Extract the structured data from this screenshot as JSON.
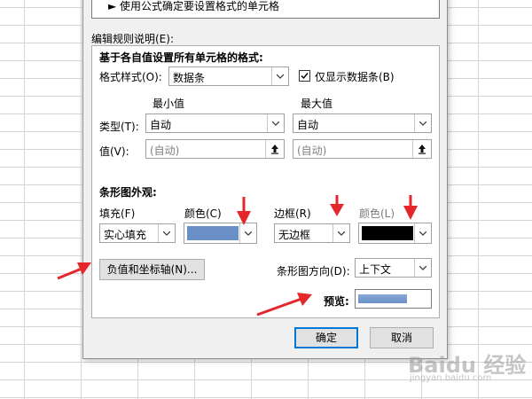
{
  "dialog": {
    "rule_type_item": "► 使用公式确定要设置格式的单元格",
    "edit_desc_label": "编辑规则说明(E):",
    "section_title": "基于各自值设置所有单元格的格式:",
    "format_style_label": "格式样式(O):",
    "format_style_value": "数据条",
    "show_bar_only_label": "仅显示数据条(B)",
    "show_bar_only_checked": true,
    "min_header": "最小值",
    "max_header": "最大值",
    "type_label": "类型(T):",
    "value_label": "值(V):",
    "min_type": "自动",
    "max_type": "自动",
    "min_value": "(自动)",
    "max_value": "(自动)",
    "bar_appearance_title": "条形图外观:",
    "fill_label": "填充(F)",
    "fill_color_label": "颜色(C)",
    "border_label": "边框(R)",
    "border_color_label": "颜色(L)",
    "fill_value": "实心填充",
    "border_value": "无边框",
    "fill_color": "#6a8fc7",
    "border_color": "#000000",
    "negative_axis_button": "负值和坐标轴(N)...",
    "bar_direction_label": "条形图方向(D):",
    "bar_direction_value": "上下文",
    "preview_label": "预览:",
    "preview_fill_percent": 70,
    "ok_button": "确定",
    "cancel_button": "取消"
  },
  "watermark": {
    "brand": "Baidu 经验",
    "url": "jingyan.baidu.com"
  }
}
